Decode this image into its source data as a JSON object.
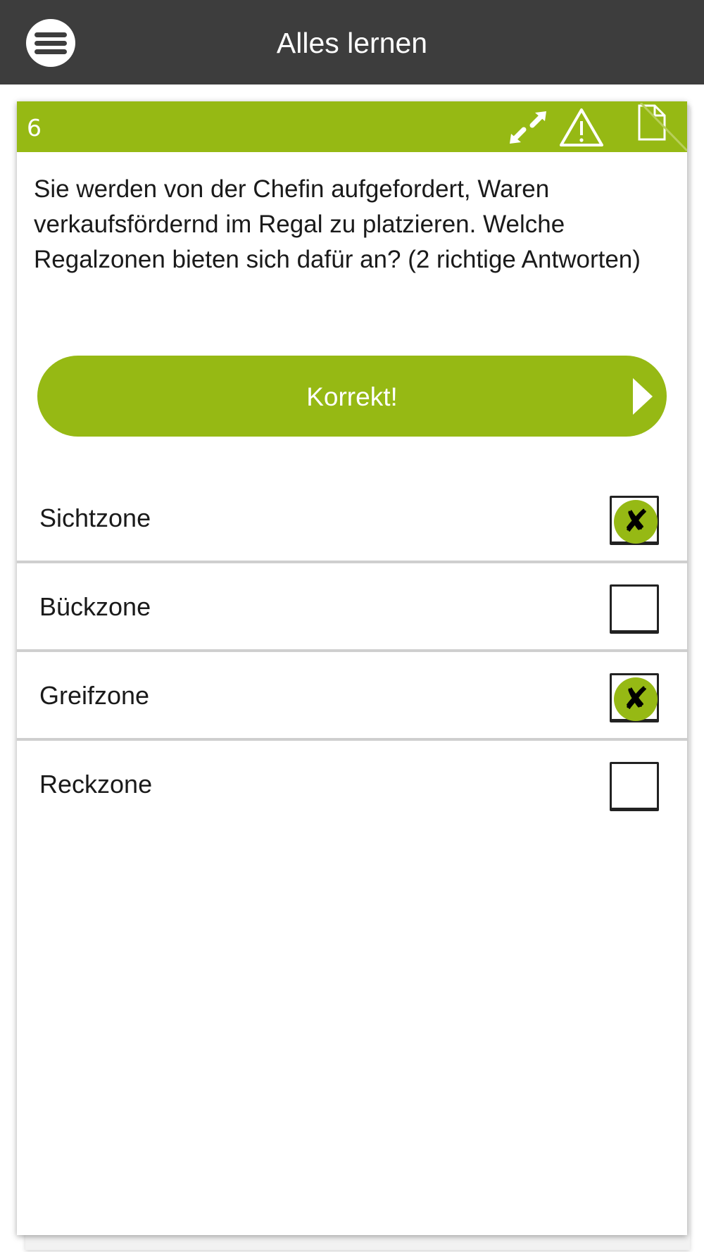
{
  "appbar": {
    "title": "Alles lernen",
    "menu_icon": "hamburger-menu-icon"
  },
  "card": {
    "question_number": "6",
    "header_icons": [
      "expand-icon",
      "warning-icon",
      "page-icon"
    ],
    "question_text": "Sie werden von der Chefin aufgefordert, Waren verkaufsfördernd im Regal zu platzieren. Welche Regalzonen bieten sich dafür an? (2 richtige Antworten)",
    "result_button": {
      "label": "Korrekt!",
      "icon": "arrow-right-icon"
    },
    "answers": [
      {
        "label": "Sichtzone",
        "checked": true,
        "mark": "✘"
      },
      {
        "label": "Bückzone",
        "checked": false,
        "mark": ""
      },
      {
        "label": "Greifzone",
        "checked": true,
        "mark": "✘"
      },
      {
        "label": "Reckzone",
        "checked": false,
        "mark": ""
      }
    ]
  },
  "colors": {
    "appbar": "#3d3d3d",
    "accent_green": "#96b914",
    "divider": "#cfcfcf",
    "text": "#1a1a1a"
  }
}
